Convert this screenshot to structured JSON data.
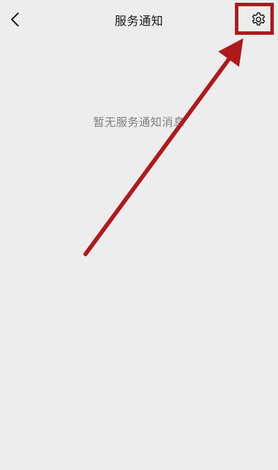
{
  "header": {
    "title": "服务通知",
    "back_icon": "chevron-left-icon",
    "settings_icon": "gear-icon"
  },
  "main": {
    "empty_message": "暂无服务通知消息"
  },
  "colors": {
    "background": "#ededed",
    "annotation": "#b0191c",
    "text_primary": "#191919",
    "text_secondary": "#7f7f7f"
  }
}
